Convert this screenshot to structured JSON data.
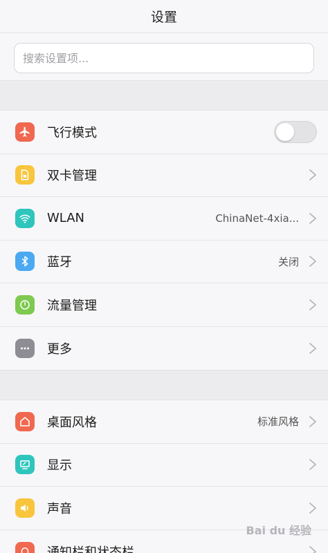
{
  "header": {
    "title": "设置"
  },
  "search": {
    "placeholder": "搜索设置项..."
  },
  "group1": [
    {
      "name": "airplane",
      "label": "飞行模式",
      "icon": "airplane-icon",
      "color": "#f0684f",
      "control": "toggle",
      "toggle_on": false
    },
    {
      "name": "dual-sim",
      "label": "双卡管理",
      "icon": "sim-card-icon",
      "color": "#f8c53c",
      "control": "chevron"
    },
    {
      "name": "wlan",
      "label": "WLAN",
      "icon": "wifi-icon",
      "color": "#2fc5bd",
      "value": "ChinaNet-4xia...",
      "control": "chevron"
    },
    {
      "name": "bluetooth",
      "label": "蓝牙",
      "icon": "bluetooth-icon",
      "color": "#4aa9f1",
      "value": "关闭",
      "control": "chevron"
    },
    {
      "name": "data-usage",
      "label": "流量管理",
      "icon": "gauge-icon",
      "color": "#7ec950",
      "control": "chevron"
    },
    {
      "name": "more",
      "label": "更多",
      "icon": "more-icon",
      "color": "#8d8d93",
      "control": "chevron"
    }
  ],
  "group2": [
    {
      "name": "desktop-style",
      "label": "桌面风格",
      "icon": "home-icon",
      "color": "#f0684f",
      "value": "标准风格",
      "control": "chevron"
    },
    {
      "name": "display",
      "label": "显示",
      "icon": "monitor-icon",
      "color": "#2fc5bd",
      "control": "chevron"
    },
    {
      "name": "sound",
      "label": "声音",
      "icon": "speaker-icon",
      "color": "#f8c53c",
      "control": "chevron"
    },
    {
      "name": "notification-bar",
      "label": "通知栏和状态栏",
      "icon": "bell-icon",
      "color": "#f0684f",
      "control": "chevron"
    }
  ],
  "watermark": {
    "text": "Bai du 经验"
  }
}
